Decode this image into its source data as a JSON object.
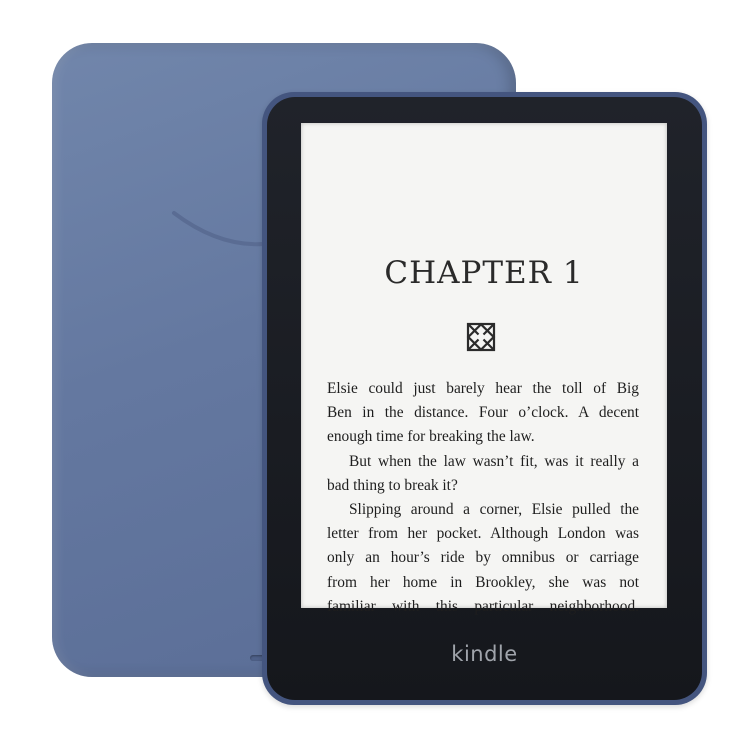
{
  "reader": {
    "chapter_title": "CHAPTER 1",
    "paragraphs": [
      {
        "indent": false,
        "lines": [
          "Elsie could just barely hear the toll of Big",
          "Ben in the distance. Four o’clock. A decent",
          "enough time for breaking the law."
        ]
      },
      {
        "indent": true,
        "lines": [
          "But when the law wasn’t fit, was it really a",
          "bad thing to break it?"
        ]
      },
      {
        "indent": true,
        "lines": [
          "Slipping around a corner, Elsie pulled the",
          "letter from her pocket. Although London was",
          "only an hour’s ride by omnibus or carriage",
          "from her home in Brookley, she was not",
          "familiar with this particular neighborhood."
        ]
      }
    ]
  },
  "device": {
    "brand_label": "kindle",
    "shell_color": "#6678a1",
    "bezel_color": "#1a1c21",
    "screen_color": "#f5f5f3"
  },
  "icons": {
    "ornament": "celtic-knot-icon",
    "back_logo": "smile-logo-icon"
  }
}
